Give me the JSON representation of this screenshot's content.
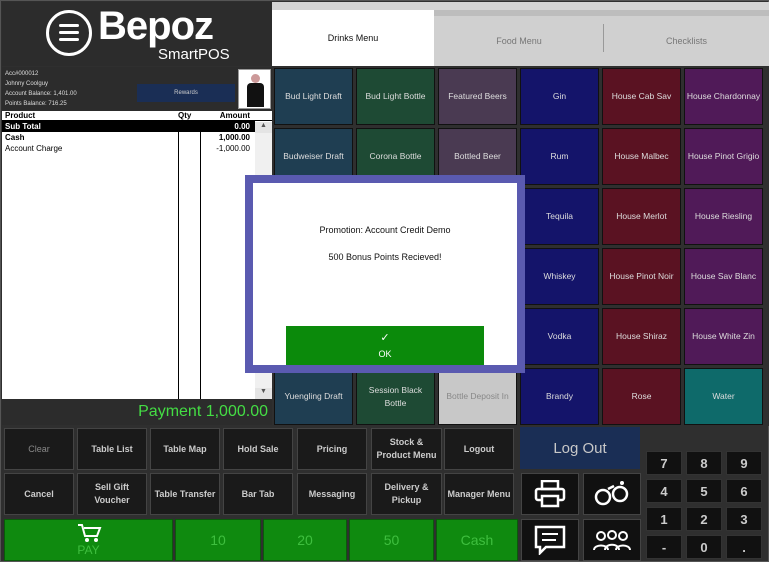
{
  "brand": {
    "name": "Bepoz",
    "sub": "SmartPOS"
  },
  "account": {
    "number": "Acc#000012",
    "name": "Johnny Coolguy",
    "balance": "Account Balance: 1,401.00",
    "points": "Points Balance: 716.25",
    "rewards_label": "Rewards"
  },
  "order": {
    "headers": {
      "product": "Product",
      "qty": "Qty",
      "amount": "Amount"
    },
    "subtotal": {
      "label": "Sub Total",
      "amount": "0.00"
    },
    "lines": [
      {
        "product": "Cash",
        "amount": "1,000.00"
      },
      {
        "product": "Account Charge",
        "amount": "-1,000.00"
      }
    ],
    "payment": "Payment 1,000.00"
  },
  "tabs": [
    "Drinks Menu",
    "Food Menu",
    "Checklists"
  ],
  "products": [
    [
      "Bud Light Draft",
      "Bud Light Bottle",
      "Featured Beers",
      "Gin",
      "House Cab Sav",
      "House Chardonnay"
    ],
    [
      "Budweiser Draft",
      "Corona Bottle",
      "Bottled Beer",
      "Rum",
      "House Malbec",
      "House Pinot Grigio"
    ],
    [
      "",
      "",
      "",
      "Tequila",
      "House Merlot",
      "House Riesling"
    ],
    [
      "",
      "",
      "",
      "Whiskey",
      "House Pinot Noir",
      "House Sav Blanc"
    ],
    [
      "",
      "",
      "",
      "Vodka",
      "House Shiraz",
      "House White Zin"
    ],
    [
      "Yuengling Draft",
      "Session Black Bottle",
      "Bottle Deposit In",
      "Brandy",
      "Rose",
      "Water"
    ]
  ],
  "colors": {
    "draft": "#1f3e52",
    "bottle": "#1e4a34",
    "beer": "#4a3a52",
    "spirit": "#14146a",
    "red": "#5a1222",
    "white": "#501a58",
    "deposit": "#c8c8c8",
    "water": "#0e6a6a"
  },
  "functions": [
    {
      "label": "Clear",
      "dim": true
    },
    {
      "label": "Table List"
    },
    {
      "label": "Table Map"
    },
    {
      "label": "Hold Sale"
    },
    {
      "label": "Pricing"
    },
    {
      "label": "Stock & Product Menu"
    },
    {
      "label": "Logout"
    },
    {
      "label": "Cancel"
    },
    {
      "label": "Sell Gift Voucher"
    },
    {
      "label": "Table Transfer"
    },
    {
      "label": "Bar Tab"
    },
    {
      "label": "Messaging"
    },
    {
      "label": "Delivery & Pickup"
    },
    {
      "label": "Manager Menu"
    }
  ],
  "pay_buttons": [
    "PAY",
    "10",
    "20",
    "50",
    "Cash"
  ],
  "logout_big": "Log Out",
  "keypad": [
    "7",
    "8",
    "9",
    "4",
    "5",
    "6",
    "1",
    "2",
    "3",
    "-",
    "0",
    "."
  ],
  "modal": {
    "line1": "Promotion: Account Credit Demo",
    "line2": "500 Bonus Points Recieved!",
    "ok_check": "✓",
    "ok_label": "OK"
  }
}
